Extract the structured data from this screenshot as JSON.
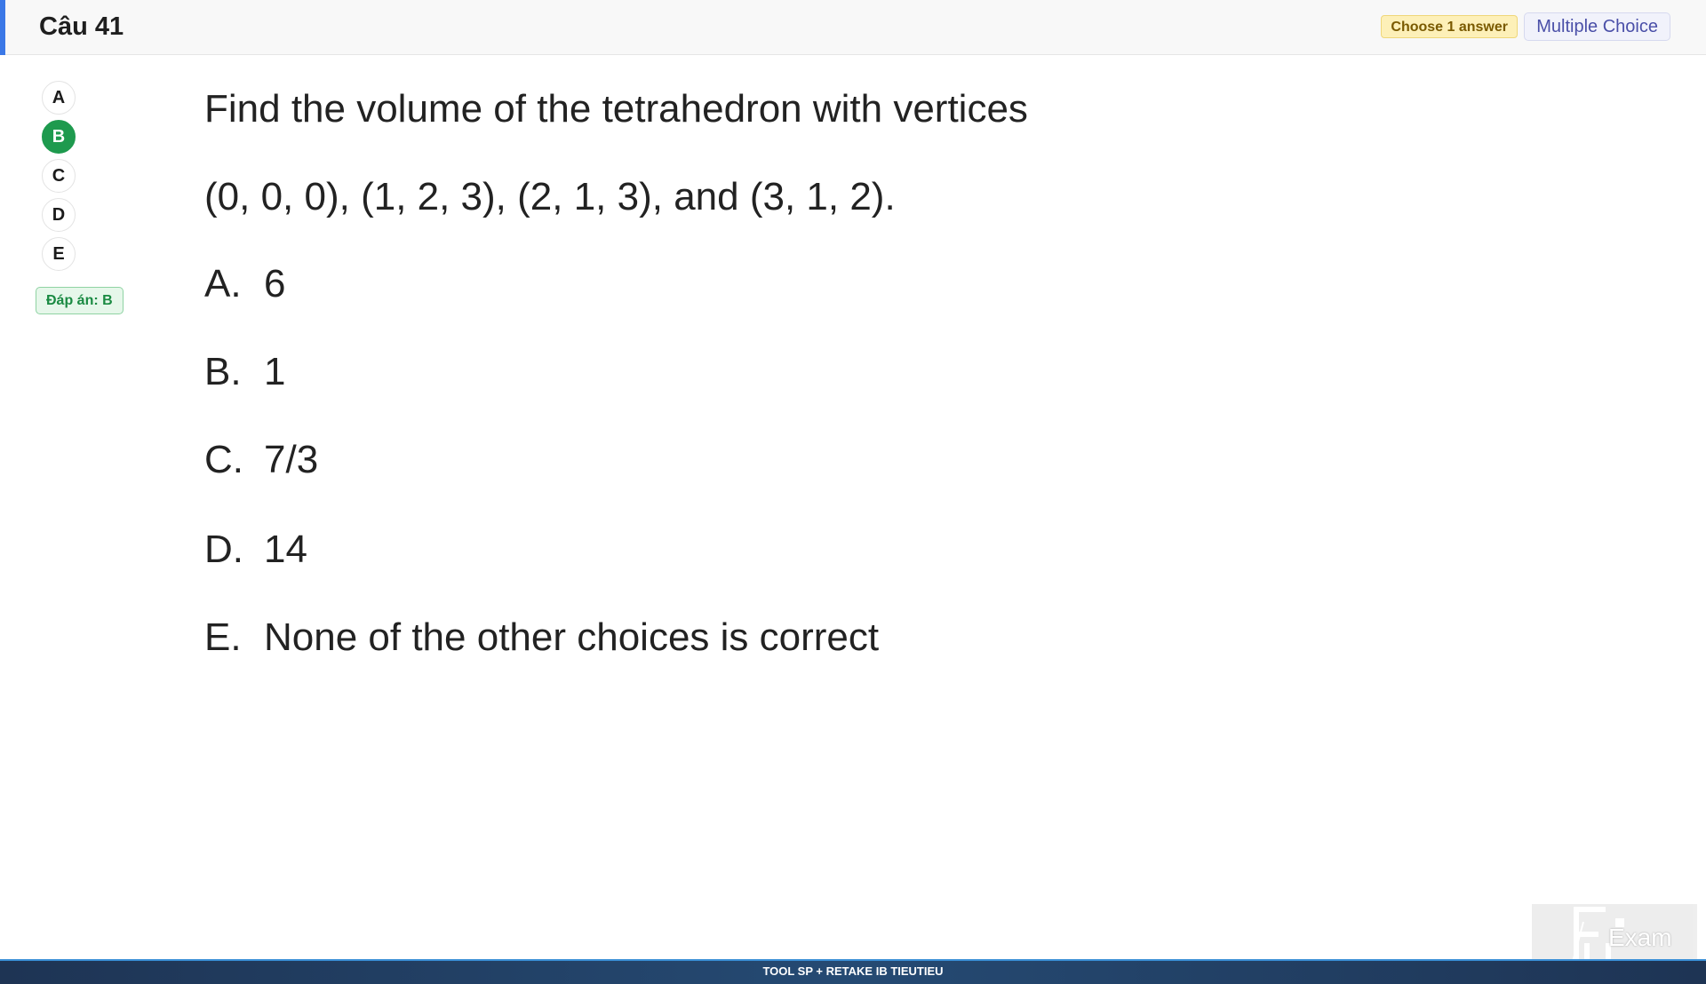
{
  "header": {
    "title": "Câu 41",
    "choose_badge": "Choose 1 answer",
    "type_badge": "Multiple Choice",
    "accent_color": "#3b78e7"
  },
  "selector": {
    "choices": [
      "A",
      "B",
      "C",
      "D",
      "E"
    ],
    "selected": "B",
    "answer_label": "Đáp án: B",
    "selected_color": "#1e9a4e"
  },
  "question": {
    "line1": "Find the volume of the tetrahedron with vertices",
    "line2": "(0, 0, 0), (1, 2, 3), (2, 1, 3), and (3, 1, 2).",
    "options": [
      {
        "letter": "A.",
        "text": "6"
      },
      {
        "letter": "B.",
        "text": "1"
      },
      {
        "letter": "C.",
        "text": "7/3"
      },
      {
        "letter": "D.",
        "text": "14"
      },
      {
        "letter": "E.",
        "text": "None of the other choices is correct"
      }
    ]
  },
  "watermark": {
    "logo_text": "Exam",
    "icon": "fu-exam-logo-icon"
  },
  "footer": {
    "text": "TOOL SP + RETAKE IB TIEUTIEU"
  }
}
